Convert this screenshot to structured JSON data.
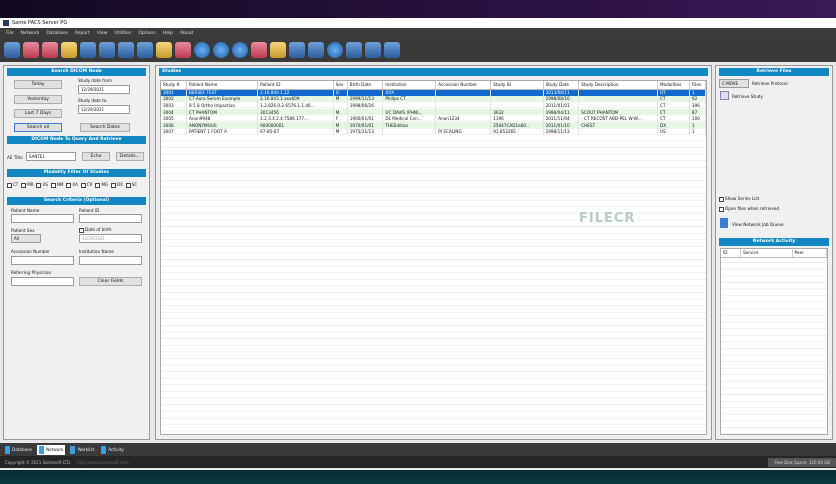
{
  "window": {
    "title": "Sante PACS Server PG"
  },
  "menu": [
    "File",
    "Network",
    "Database",
    "Report",
    "View",
    "Utilities",
    "Options",
    "Help",
    "About"
  ],
  "left": {
    "search_header": "Search DICOM Node",
    "today": "Today",
    "yesterday": "Yesterday",
    "last7": "Last 7 Days",
    "search_all": "Search all",
    "search_dates": "Search Dates",
    "date_from_label": "Study date from",
    "date_from": "12/29/2021",
    "date_to_label": "Study date to",
    "date_to": "12/29/2021",
    "node_header": "DICOM Node To Query And Retrieve",
    "ae_title_label": "AE Title",
    "ae_title": "SANTE1",
    "echo": "Echo",
    "details": "Details...",
    "modality_header": "Modality Filter Of Studies",
    "modalities": [
      "CT",
      "MR",
      "US",
      "NM",
      "XA",
      "CR",
      "MG",
      "DX",
      "SC"
    ],
    "criteria_header": "Search Criteria (Optional)",
    "patient_name": "Patient Name",
    "patient_id": "Patient ID",
    "patient_sex": "Patient Sex",
    "sex_value": "All",
    "dob": "Date of birth",
    "dob_value": "12/29/2021",
    "accession": "Accession Number",
    "institution": "Institution Name",
    "referring": "Referring Physician",
    "clear": "Clear Fields"
  },
  "studies": {
    "header": "Studies",
    "columns": [
      "Study #",
      "Patient Name",
      "Patient ID",
      "Sex",
      "Birth Date",
      "Institution",
      "Accession Number",
      "Study ID",
      "Study Date",
      "Study Description",
      "Modalities",
      "Files"
    ],
    "rows": [
      [
        "3001",
        "BERSEF TEST",
        "2.16.840.1.22",
        "O",
        "",
        "XXX",
        "",
        "",
        "2013/08/11",
        "",
        "OT",
        "1"
      ],
      [
        "3002",
        "CT Aura Serum Example",
        "2.16.843.1.xxx609",
        "M",
        "1999/11/13",
        "Philips CT",
        "",
        "",
        "1998/08/10",
        "",
        "CT",
        "92"
      ],
      [
        "3003",
        "8 5 8 Ortho Impaction",
        "1.2.826.0.2.6576.1.1.46...",
        "",
        "1998/06/26",
        "",
        "",
        "",
        "2011/01/01",
        "",
        "CT",
        "396"
      ],
      [
        "3004",
        "CT PHANTOM",
        "3013456",
        "M",
        "",
        "UC DAVIS (PHN)...",
        "",
        "3632",
        "1998/04/11",
        "SCOUT PHANTOM",
        "CT",
        "87"
      ],
      [
        "3005",
        "Anon9948",
        "1.2.3.4.2.4.7586.177...",
        "F",
        "1900/01/01",
        "DL Medical Cen...",
        "Anon1234",
        "1196",
        "2011/11/04",
        "- CT RECOST ABD-PEL W-W...",
        "CT",
        "100"
      ],
      [
        "3006",
        "ANONYMOUS",
        "900000001",
        "M",
        "1970/01/01",
        "THEEdition",
        "",
        "25047CAD1a00...",
        "2011/01/10",
        "CHEST",
        "DX",
        "1"
      ],
      [
        "3007",
        "PATIENT 1 FOOT A",
        "67-85-07",
        "M",
        "1975/11/13",
        "",
        "PI SCALING",
        "91.853265",
        "1998/11/13",
        "",
        "US",
        "1"
      ]
    ],
    "selected_row": 0
  },
  "right": {
    "header": "Retrieve Files",
    "protocol": "C-MOVE",
    "protocol_label": "Retrieve Protocol",
    "retrieve": "Retrieve Study",
    "show_series": "Show Series List",
    "open_files": "Open files when retrieved",
    "queue": "View Network Job Queue",
    "activity_header": "Network Activity",
    "activity_cols": [
      "ID",
      "Service",
      "Peer"
    ]
  },
  "tabs": [
    "Database",
    "Network",
    "Worklist",
    "Activity"
  ],
  "active_tab": 1,
  "watermark": "FILECR",
  "status": {
    "copyright": "Copyright © 2021 Santesoft LTD.",
    "url": "http://www.santesoft.com",
    "disk": "Free Disk Space: 120.00 GB"
  }
}
